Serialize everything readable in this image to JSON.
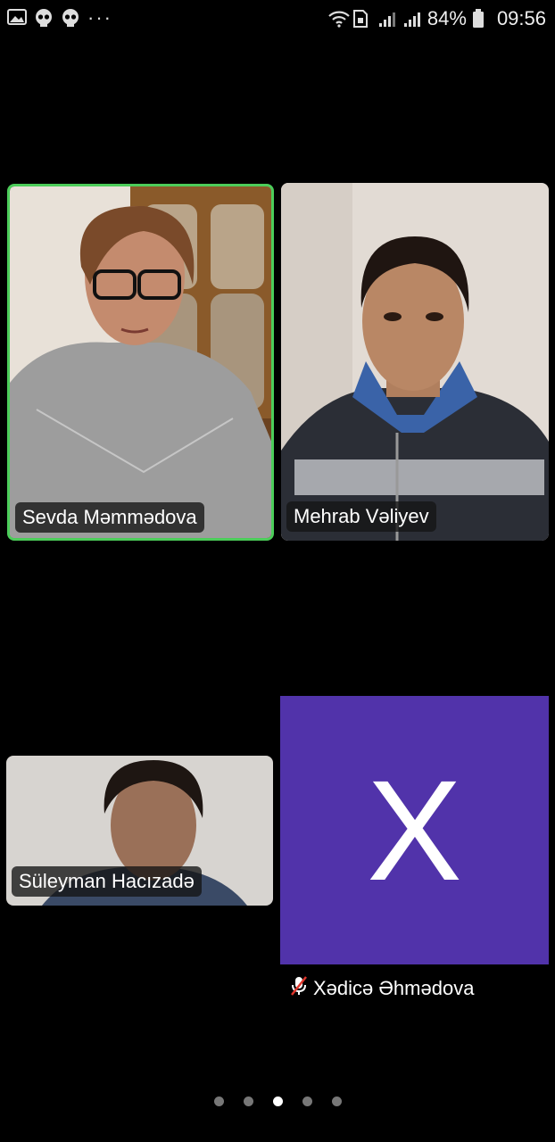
{
  "status_bar": {
    "battery": "84%",
    "time": "09:56",
    "more": "···"
  },
  "participants": [
    {
      "name": "Sevda Məmmədova",
      "active_speaker": true
    },
    {
      "name": "Mehrab Vəliyev",
      "active_speaker": false
    },
    {
      "name": "Süleyman Hacızadə",
      "active_speaker": false
    },
    {
      "name": "Xədicə Əhmədova",
      "initial": "X",
      "muted": true,
      "avatar_color": "#5133aa"
    }
  ],
  "pager": {
    "count": 5,
    "current": 3
  },
  "colors": {
    "active_border": "#4ccd5a",
    "background": "#000000"
  }
}
